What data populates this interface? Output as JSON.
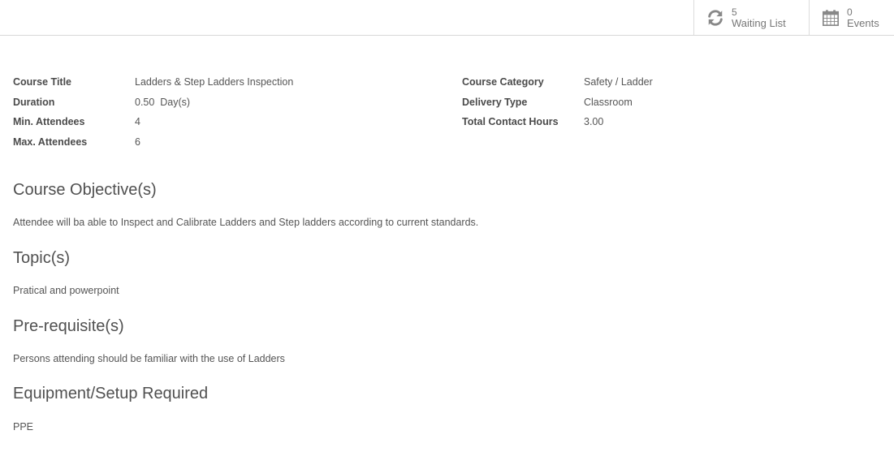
{
  "header": {
    "waiting_list": {
      "count": "5",
      "label": "Waiting List",
      "icon": "refresh-icon"
    },
    "events": {
      "count": "0",
      "label": "Events",
      "icon": "calendar-icon"
    }
  },
  "details_left": [
    {
      "label": "Course Title",
      "value": "Ladders & Step Ladders Inspection"
    },
    {
      "label": "Duration",
      "value": "0.50  Day(s)"
    },
    {
      "label": "Min. Attendees",
      "value": "4"
    },
    {
      "label": "Max. Attendees",
      "value": "6"
    }
  ],
  "details_right": [
    {
      "label": "Course Category",
      "value": "Safety / Ladder"
    },
    {
      "label": "Delivery Type",
      "value": "Classroom"
    },
    {
      "label": "Total Contact Hours",
      "value": "3.00"
    }
  ],
  "sections": [
    {
      "title": "Course Objective(s)",
      "text": "Attendee will ba able to Inspect and Calibrate Ladders and Step ladders according to current standards."
    },
    {
      "title": "Topic(s)",
      "text": "Pratical and powerpoint"
    },
    {
      "title": "Pre-requisite(s)",
      "text": "Persons attending should be familiar with the use of Ladders"
    },
    {
      "title": "Equipment/Setup Required",
      "text": "PPE"
    }
  ]
}
